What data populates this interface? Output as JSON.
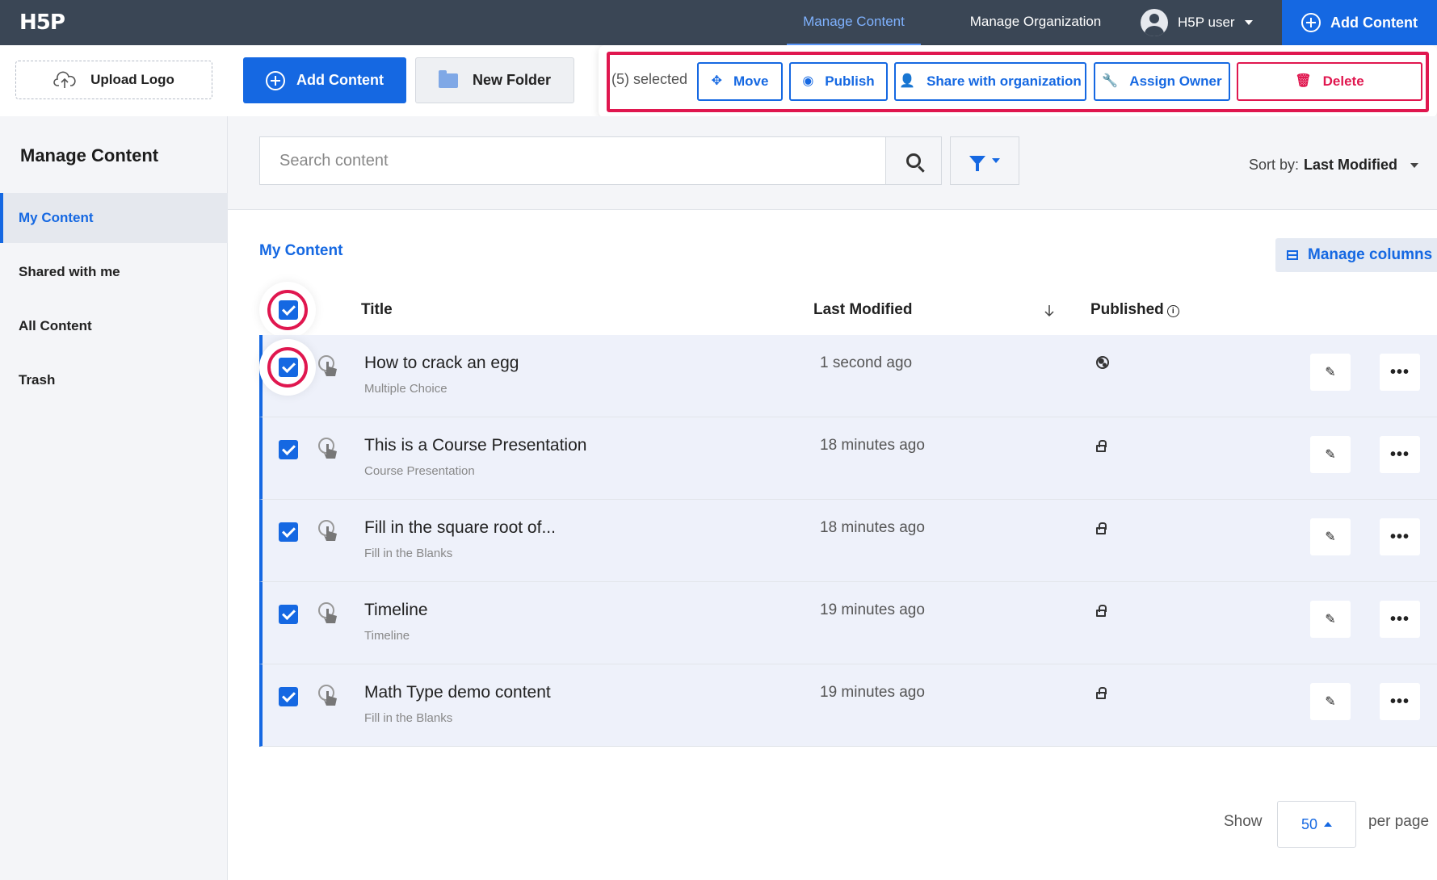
{
  "app": {
    "logo": "H5P"
  },
  "topnav": {
    "items": [
      "Manage Content",
      "Manage Organization"
    ],
    "user": "H5P user",
    "add_content": "Add Content"
  },
  "sidebar": {
    "upload_logo": "Upload Logo",
    "title": "Manage Content",
    "items": [
      "My Content",
      "Shared with me",
      "All Content",
      "Trash"
    ]
  },
  "toolbar": {
    "add_content": "Add Content",
    "new_folder": "New Folder",
    "selected": "(5) selected",
    "actions": [
      "Move",
      "Publish",
      "Share with organization",
      "Assign Owner",
      "Delete"
    ]
  },
  "search": {
    "placeholder": "Search content",
    "sort_label": "Sort by:",
    "sort_value": "Last Modified"
  },
  "content": {
    "breadcrumb": "My Content",
    "manage_columns": "Manage columns",
    "columns": {
      "title": "Title",
      "modified": "Last Modified",
      "published": "Published"
    },
    "rows": [
      {
        "title": "How to crack an egg",
        "type": "Multiple Choice",
        "modified": "1 second ago",
        "published_icon": "globe-icon"
      },
      {
        "title": "This is a Course Presentation",
        "type": "Course Presentation",
        "modified": "18 minutes ago",
        "published_icon": "lock-icon"
      },
      {
        "title": "Fill in the square root of...",
        "type": "Fill in the Blanks",
        "modified": "18 minutes ago",
        "published_icon": "lock-icon"
      },
      {
        "title": "Timeline",
        "type": "Timeline",
        "modified": "19 minutes ago",
        "published_icon": "lock-icon"
      },
      {
        "title": "Math Type demo content",
        "type": "Fill in the Blanks",
        "modified": "19 minutes ago",
        "published_icon": "lock-icon"
      }
    ]
  },
  "pagination": {
    "show": "Show",
    "per_page_value": "50",
    "per_page": "per page"
  },
  "colors": {
    "primary": "#1568e2",
    "danger": "#e0174f",
    "topbar": "#3a4655"
  }
}
